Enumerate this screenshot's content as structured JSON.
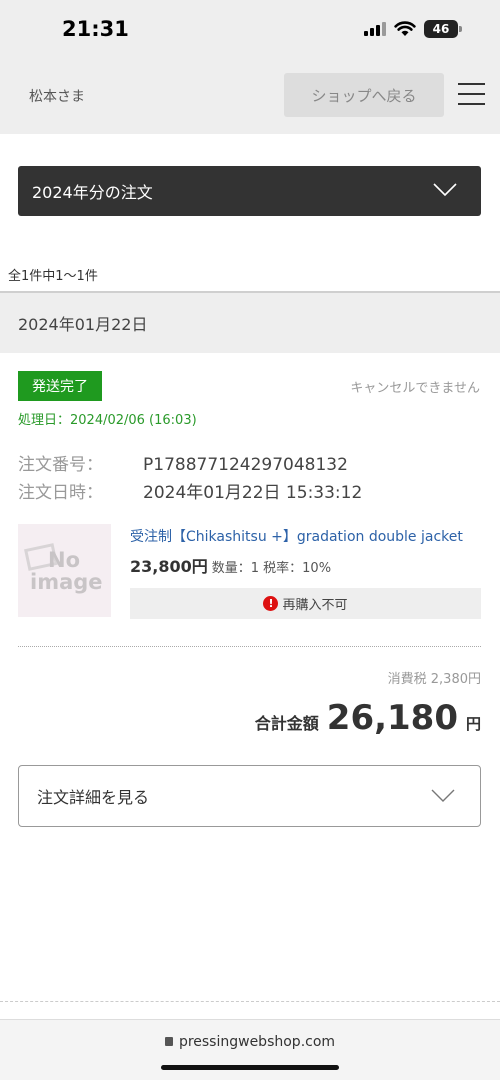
{
  "status_bar": {
    "time": "21:31",
    "battery": "46"
  },
  "header": {
    "user_name": "松本さま",
    "shop_button": "ショップへ戻る"
  },
  "filter": {
    "selected": "2024年分の注文"
  },
  "result_count": "全1件中1〜1件",
  "order": {
    "date": "2024年01月22日",
    "status": "発送完了",
    "cancel_note": "キャンセルできません",
    "processed": "処理日：2024/02/06 (16:03)",
    "number_label": "注文番号：",
    "number": "P178877124297048132",
    "datetime_label": "注文日時：",
    "datetime": "2024年01月22日 15:33:12",
    "item": {
      "thumb_no": "No",
      "thumb_image": "image",
      "name": "受注制【Chikashitsu +】gradation double jacket",
      "price": "23,800円",
      "meta": "数量：1 税率：10%",
      "rebuy": "再購入不可"
    },
    "tax": "消費税 2,380円",
    "total_label": "合計金額",
    "total_value": "26,180",
    "total_unit": "円",
    "details_button": "注文詳細を見る"
  },
  "browser": {
    "url": "pressingwebshop.com"
  }
}
